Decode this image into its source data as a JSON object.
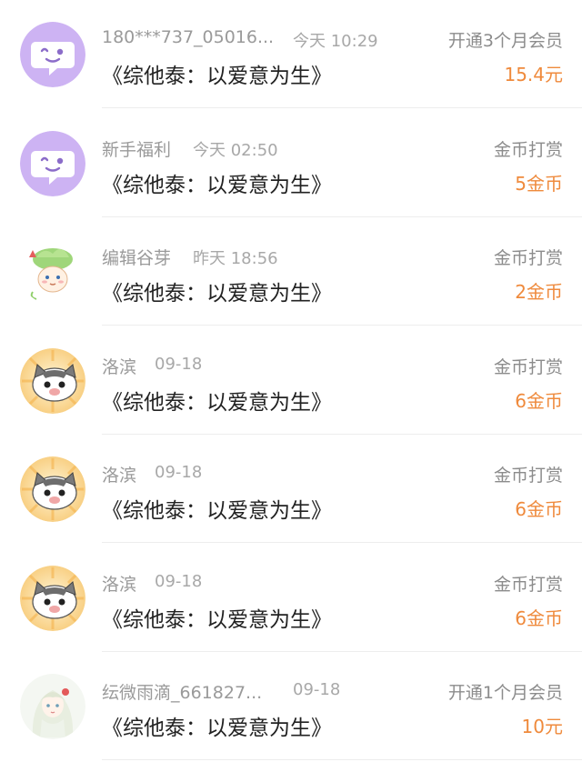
{
  "records": [
    {
      "user": "180***737_05016...",
      "time": "今天 10:29",
      "book": "《综他泰：以爱意为生》",
      "type": "开通3个月会员",
      "amount": "15.4元",
      "avatar": "purple-chat-icon"
    },
    {
      "user": "新手福利",
      "time": "今天 02:50",
      "book": "《综他泰：以爱意为生》",
      "type": "金币打赏",
      "amount": "5金币",
      "avatar": "purple-chat-icon"
    },
    {
      "user": "编辑谷芽",
      "time": "昨天 18:56",
      "book": "《综他泰：以爱意为生》",
      "type": "金币打赏",
      "amount": "2金币",
      "avatar": "sprout-character-avatar"
    },
    {
      "user": "洛滨",
      "time": "09-18",
      "book": "《综他泰：以爱意为生》",
      "type": "金币打赏",
      "amount": "6金币",
      "avatar": "cat-avatar"
    },
    {
      "user": "洛滨",
      "time": "09-18",
      "book": "《综他泰：以爱意为生》",
      "type": "金币打赏",
      "amount": "6金币",
      "avatar": "cat-avatar"
    },
    {
      "user": "洛滨",
      "time": "09-18",
      "book": "《综他泰：以爱意为生》",
      "type": "金币打赏",
      "amount": "6金币",
      "avatar": "cat-avatar"
    },
    {
      "user": "纭微雨滴_661827...",
      "time": "09-18",
      "book": "《综他泰：以爱意为生》",
      "type": "开通1个月会员",
      "amount": "10元",
      "avatar": "anime-girl-avatar"
    }
  ],
  "colors": {
    "amount": "#ef8a3c",
    "muted_text": "#9a9a9a",
    "title_text": "#222222",
    "avatar_purple": "#cdb3f3"
  }
}
